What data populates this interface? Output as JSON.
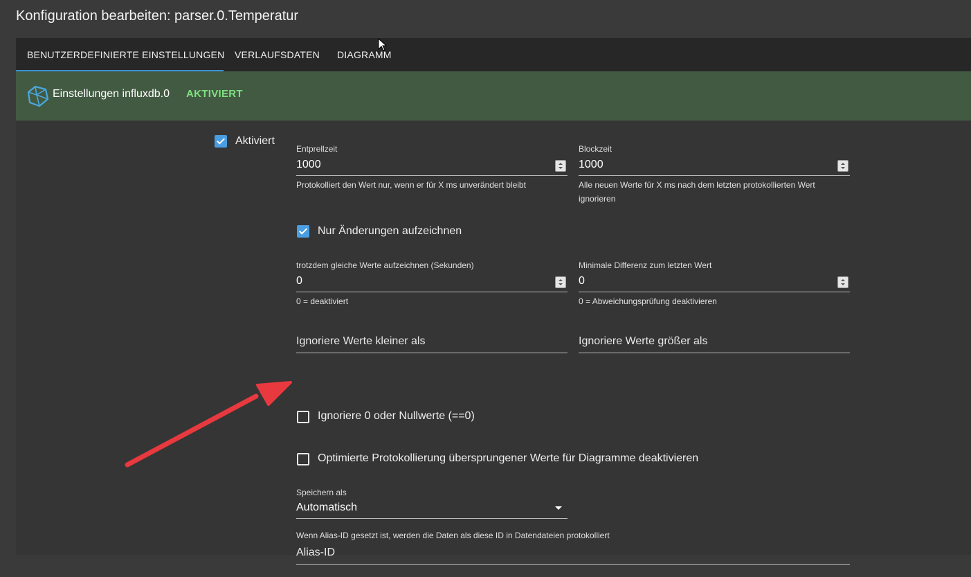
{
  "dialog": {
    "title": "Konfiguration bearbeiten: parser.0.Temperatur"
  },
  "tabs": [
    {
      "label": "BENUTZERDEFINIERTE EINSTELLUNGEN",
      "active": true
    },
    {
      "label": "VERLAUFSDATEN",
      "active": false
    },
    {
      "label": "DIAGRAMM",
      "active": false
    }
  ],
  "banner": {
    "icon": "influxdb-icon",
    "title": "Einstellungen influxdb.0",
    "status": "AKTIVIERT",
    "status_color": "#7ee07e",
    "background_color": "#425a42"
  },
  "settings": {
    "enabled": {
      "label": "Aktiviert",
      "checked": true
    },
    "debounce": {
      "label": "Entprellzeit",
      "value": "1000",
      "helper": "Protokolliert den Wert nur, wenn er für X ms unverändert bleibt"
    },
    "blocktime": {
      "label": "Blockzeit",
      "value": "1000",
      "helper_line1": "Alle neuen Werte für X ms nach dem letzten protokollierten Wert",
      "helper_line2": "ignorieren"
    },
    "changes_only": {
      "label": "Nur Änderungen aufzeichnen",
      "checked": true
    },
    "changes_relog": {
      "label": "trotzdem gleiche Werte aufzeichnen (Sekunden)",
      "value": "0",
      "helper": "0 = deaktiviert"
    },
    "changes_min_delta": {
      "label": "Minimale Differenz zum letzten Wert",
      "value": "0",
      "helper": "0 = Abweichungsprüfung deaktivieren"
    },
    "ignore_below": {
      "placeholder": "Ignoriere Werte kleiner als"
    },
    "ignore_above": {
      "placeholder": "Ignoriere Werte größer als"
    },
    "ignore_zero": {
      "label": "Ignoriere 0 oder Nullwerte (==0)",
      "checked": false
    },
    "disable_skipped": {
      "label": "Optimierte Protokollierung übersprungener Werte für Diagramme deaktivieren",
      "checked": false
    },
    "store_as": {
      "label": "Speichern als",
      "value": "Automatisch"
    },
    "alias_id": {
      "placeholder": "Alias-ID",
      "helper": "Wenn Alias-ID gesetzt ist, werden die Daten als diese ID in Datendateien protokolliert"
    }
  },
  "colors": {
    "accent": "#3b8fd8",
    "checkbox": "#4a9de0",
    "annotation_arrow": "#e8393f"
  }
}
